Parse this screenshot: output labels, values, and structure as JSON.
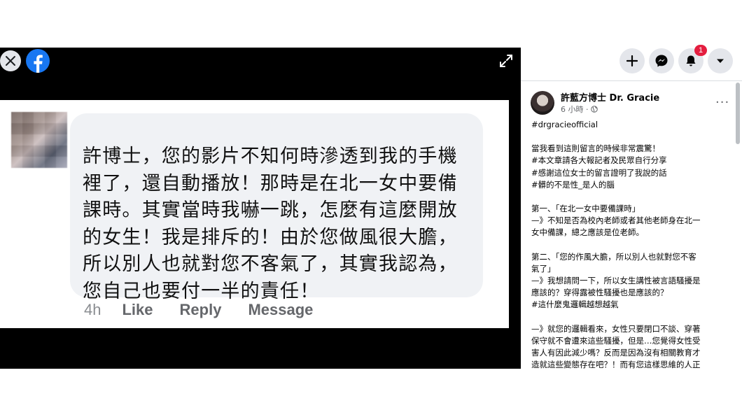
{
  "viewer": {
    "comment": {
      "lines": [
        "許博士，您的影片不知何時滲透到我的手機",
        "裡了，還自動播放！那時是在北一女中要備",
        "課時。其實當時我嚇一跳，怎麼有這麼開放",
        "的女生！我是排斥的！由於您做風很大膽，",
        "所以別人也就對您不客氣了，其實我認為，",
        "您自己也要付一半的責任！"
      ],
      "time": "4h",
      "like": "Like",
      "reply": "Reply",
      "message": "Message"
    }
  },
  "topbar": {
    "notification_count": "1"
  },
  "post": {
    "author": "許藍方博士 Dr. Gracie",
    "time": "6 小時 ·",
    "more": "···",
    "body": [
      "#drgracieofficial",
      "",
      "當我看到這則留言的時候非常震驚！",
      "#本文章請各大報記者及民眾自行分享",
      "#感謝這位女士的留言證明了我說的話",
      "#髒的不是性_是人的腦",
      "",
      "第一、「在北一女中要備課時」",
      "—》不知是否為校內老師或者其他老師身在北一",
      "女中備課，總之應該是位老師。",
      "",
      "第二、「您的作風大膽，所以別人也就對您不客",
      "氣了」",
      "—》我想請問一下，所以女生講性被言語騷擾是",
      "應該的？穿得露被性騷擾也是應該的？",
      "#這什麼鬼邏輯越想越氣",
      "",
      "—》就您的邏輯看來，女性只要閉口不談、穿著",
      "保守就不會遭來這些騷擾，但是…您覺得女性受",
      "害人有因此減少嗎？反而是因為沒有相關教育才",
      "造就這些變態存在吧？！而有您這樣思維的人正"
    ]
  }
}
